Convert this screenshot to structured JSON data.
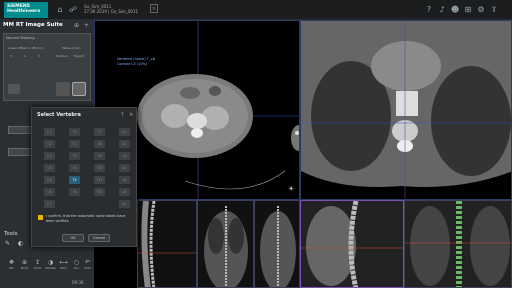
{
  "topbar": {
    "brand_line1": "SIEMENS",
    "brand_line2": "Healthineers",
    "patient_name": "Go_Sim_0011",
    "patient_info": "27.06.2019 | Go_Sim_0011",
    "icons": [
      "home-icon",
      "patient-browser-icon",
      "help-icon",
      "bell-icon",
      "users-icon",
      "layout-icon",
      "share-icon"
    ]
  },
  "app": {
    "title": "MM RT Image Suite",
    "masking_label": "Volume Masking",
    "lower_offset_label": "Lower Offset in dB (cm)",
    "tables_label": "Tables (mm)",
    "position_label": "Position",
    "height_label": "Height",
    "values": [
      "5",
      "4",
      "5"
    ]
  },
  "dialog": {
    "title": "Select Vertebra",
    "help": "?",
    "close": "×",
    "vertebrae": [
      [
        "C1",
        "T1",
        "T7",
        "L1"
      ],
      [
        "C2",
        "T2",
        "T8",
        "L2"
      ],
      [
        "C3",
        "T3",
        "T9",
        "L3"
      ],
      [
        "C4",
        "T4",
        "T10",
        "L4"
      ],
      [
        "C5",
        "T5",
        "T11",
        "L5"
      ],
      [
        "C6",
        "T6",
        "T12",
        "L6"
      ],
      [
        "C7",
        "",
        "",
        "S1"
      ]
    ],
    "selected": "T5",
    "confirm": "I confirm, that the automatic spine labels have been verified.",
    "ok": "OK",
    "cancel": "Cancel"
  },
  "tools": {
    "label": "Tools",
    "items": [
      "Pan",
      "Zoom",
      "Scroll",
      "Window",
      "Ruler",
      "Roi",
      "Undo"
    ]
  },
  "clock": "09:36",
  "axial": {
    "annot1": "Vertebra (Spine) T_x8",
    "annot2": "Lumbar L3 (10%)"
  },
  "colors": {
    "accent": "#008c8c",
    "selected_vertebra": "#2a5f7a",
    "checkbox": "#e8b400",
    "viewport_border": "#2e3a66",
    "sagittal_border": "#7a4fb8"
  }
}
